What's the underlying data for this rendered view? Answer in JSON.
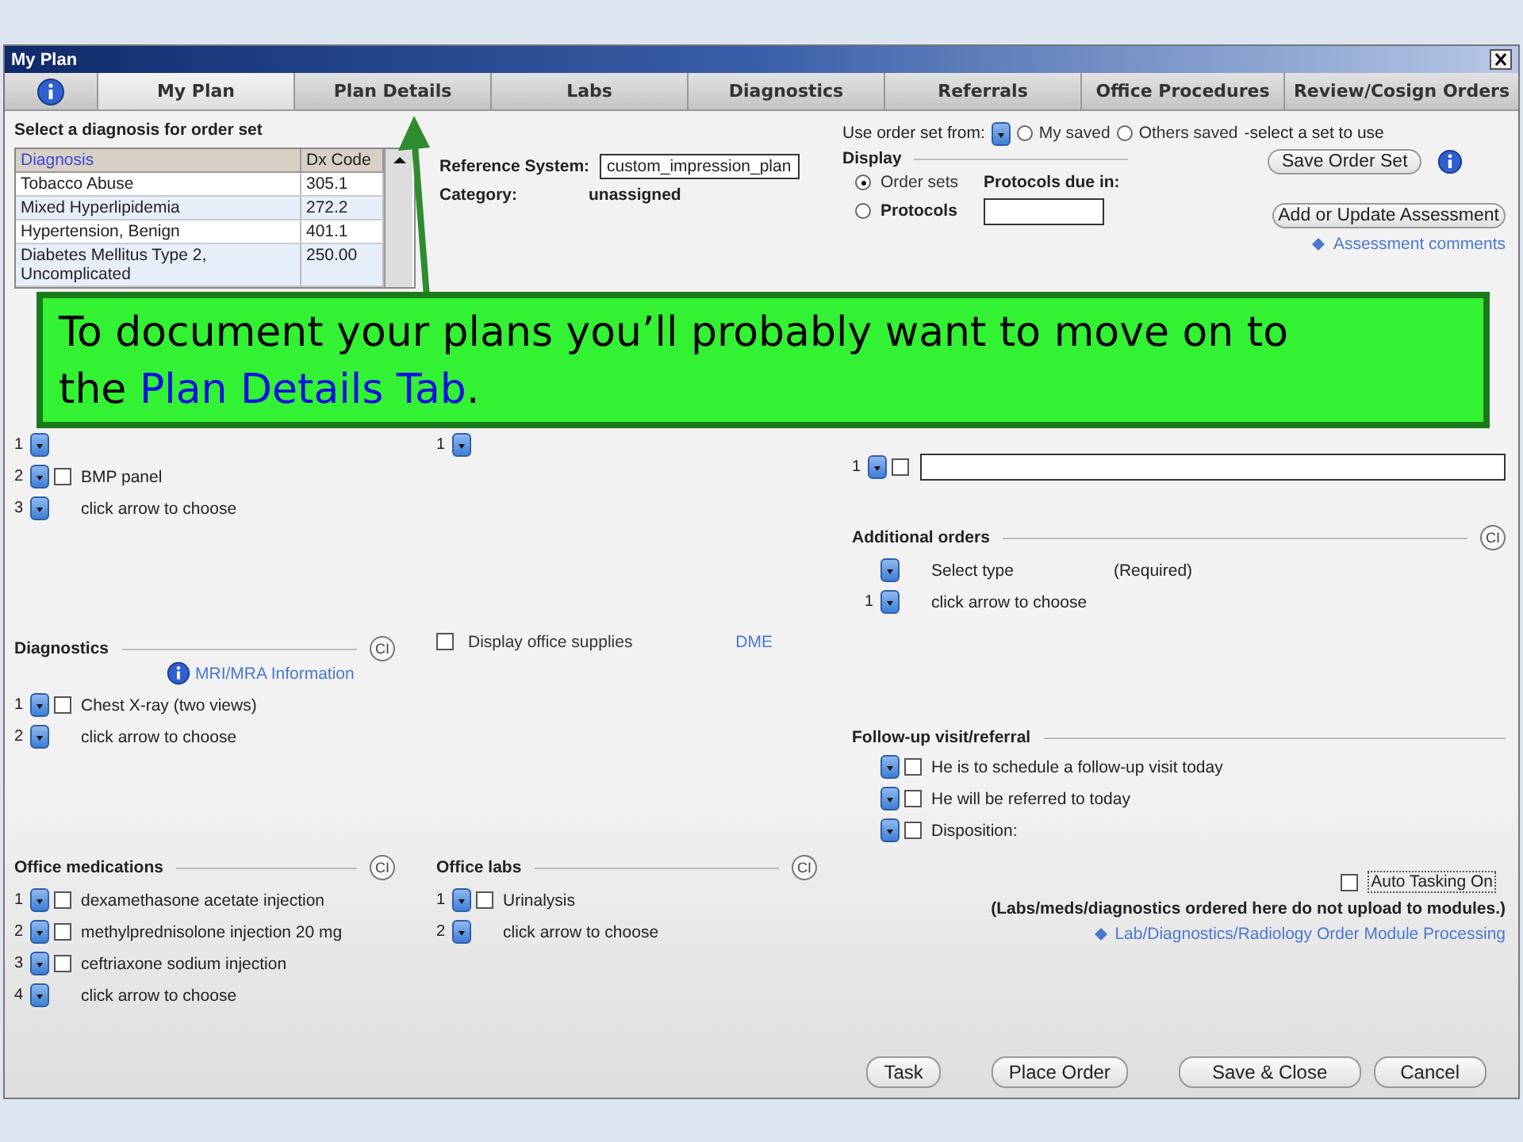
{
  "window": {
    "title": "My Plan"
  },
  "tabs": [
    {
      "label": "My Plan",
      "selected": true
    },
    {
      "label": "Plan Details",
      "selected": false
    },
    {
      "label": "Labs",
      "selected": false
    },
    {
      "label": "Diagnostics",
      "selected": false
    },
    {
      "label": "Referrals",
      "selected": false
    },
    {
      "label": "Office Procedures",
      "selected": false
    },
    {
      "label": "Review/Cosign Orders",
      "selected": false
    }
  ],
  "diagnosis_panel": {
    "title": "Select a diagnosis for order set",
    "columns": [
      "Diagnosis",
      "Dx Code"
    ],
    "rows": [
      {
        "diagnosis": "Tobacco Abuse",
        "code": "305.1"
      },
      {
        "diagnosis": "Mixed Hyperlipidemia",
        "code": "272.2"
      },
      {
        "diagnosis": "Hypertension, Benign",
        "code": "401.1"
      },
      {
        "diagnosis": "Diabetes Mellitus Type 2, Uncomplicated",
        "code": "250.00"
      }
    ]
  },
  "reference": {
    "label": "Reference System:",
    "value": "custom_impression_plan",
    "category_label": "Category:",
    "category": "unassigned"
  },
  "order_set": {
    "label": "Use order set from:",
    "options": [
      {
        "label": "My saved",
        "selected": false
      },
      {
        "label": "Others saved",
        "selected": false
      }
    ],
    "hint": "-select a set to use",
    "save_button": "Save Order Set"
  },
  "display": {
    "title": "Display",
    "options": [
      {
        "label": "Order sets",
        "selected": true
      },
      {
        "label": "Protocols",
        "selected": false
      }
    ],
    "protocols_label": "Protocols due in:"
  },
  "assessment": {
    "button": "Add or Update Assessment",
    "link": "Assessment comments"
  },
  "callout": {
    "before": "To document your plans you’ll probably want to move on to the ",
    "highlight": "Plan Details Tab",
    "after": "."
  },
  "columns": [
    {
      "sections": [
        {
          "kind": "list",
          "rows": [
            {
              "number": "1",
              "kind": "empty"
            },
            {
              "number": "2",
              "kind": "check",
              "checked": false,
              "text": "BMP panel"
            },
            {
              "number": "3",
              "kind": "choose",
              "text": "click arrow to choose"
            }
          ]
        },
        {
          "kind": "list",
          "title": "Diagnostics",
          "clear": "CI",
          "link": "MRI/MRA Information",
          "rows": [
            {
              "number": "1",
              "kind": "check",
              "checked": false,
              "text": "Chest X-ray (two views)"
            },
            {
              "number": "2",
              "kind": "choose",
              "text": "click arrow to choose"
            }
          ]
        },
        {
          "kind": "list",
          "title": "Office medications",
          "clear": "CI",
          "rows": [
            {
              "number": "1",
              "kind": "check",
              "checked": false,
              "text": "dexamethasone acetate injection"
            },
            {
              "number": "2",
              "kind": "check",
              "checked": false,
              "text": "methylprednisolone injection 20 mg"
            },
            {
              "number": "3",
              "kind": "check",
              "checked": false,
              "text": "ceftriaxone sodium injection"
            },
            {
              "number": "4",
              "kind": "choose",
              "text": "click arrow to choose"
            }
          ]
        }
      ]
    },
    {
      "sections": [
        {
          "kind": "list",
          "rows": [
            {
              "number": "1",
              "kind": "empty"
            }
          ]
        },
        {
          "kind": "supplies",
          "label": "Display office supplies",
          "checked": false,
          "link": "DME"
        },
        {
          "kind": "list",
          "title": "Office labs",
          "clear": "CI",
          "rows": [
            {
              "number": "1",
              "kind": "check",
              "checked": false,
              "text": "Urinalysis"
            },
            {
              "number": "2",
              "kind": "choose",
              "text": "click arrow to choose"
            }
          ]
        }
      ]
    },
    {
      "sections": [
        {
          "kind": "instruction",
          "number": "1",
          "checked": false
        },
        {
          "kind": "list",
          "title": "Additional orders",
          "clear": "CI",
          "rows": [
            {
              "number": "",
              "kind": "type",
              "text": "Select type",
              "note": "(Required)"
            },
            {
              "number": "1",
              "kind": "choose",
              "text": "click arrow to choose"
            }
          ]
        },
        {
          "kind": "list",
          "title": "Follow-up visit/referral",
          "rows": [
            {
              "number": "",
              "kind": "check",
              "checked": false,
              "text": "He is to schedule a follow-up visit today"
            },
            {
              "number": "",
              "kind": "check",
              "checked": false,
              "text": "He will be referred to today"
            },
            {
              "number": "",
              "kind": "check",
              "checked": false,
              "text": "Disposition:"
            }
          ]
        }
      ]
    }
  ],
  "auto_tasking": {
    "label": "Auto Tasking On",
    "checked": false
  },
  "note": "(Labs/meds/diagnostics ordered here do not upload to modules.)",
  "module_link": "Lab/Diagnostics/Radiology Order Module Processing",
  "buttons": [
    "Task",
    "Place Order",
    "Save & Close",
    "Cancel"
  ]
}
